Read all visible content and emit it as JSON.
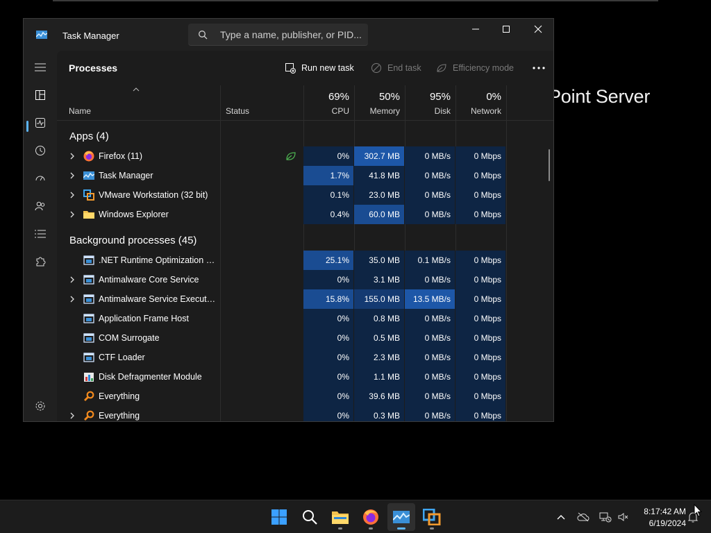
{
  "background": {
    "text": "Point Server"
  },
  "window": {
    "title": "Task Manager",
    "search_placeholder": "Type a name, publisher, or PID..."
  },
  "toolbar": {
    "page_title": "Processes",
    "run_new_task": "Run new task",
    "end_task": "End task",
    "efficiency_mode": "Efficiency mode"
  },
  "columns": {
    "name": "Name",
    "status": "Status",
    "cpu": {
      "pct": "69%",
      "label": "CPU"
    },
    "memory": {
      "pct": "50%",
      "label": "Memory"
    },
    "disk": {
      "pct": "95%",
      "label": "Disk"
    },
    "network": {
      "pct": "0%",
      "label": "Network"
    }
  },
  "groups": {
    "apps": "Apps (4)",
    "background": "Background processes (45)"
  },
  "apps": [
    {
      "name": "Firefox (11)",
      "icon": "firefox-icon",
      "status": "efficiency-leaf-icon",
      "cpu": "0%",
      "memory": "302.7 MB",
      "disk": "0 MB/s",
      "network": "0 Mbps",
      "heat": [
        0,
        3,
        0,
        0
      ]
    },
    {
      "name": "Task Manager",
      "icon": "task-manager-icon",
      "cpu": "1.7%",
      "memory": "41.8 MB",
      "disk": "0 MB/s",
      "network": "0 Mbps",
      "heat": [
        2,
        0,
        0,
        0
      ]
    },
    {
      "name": "VMware Workstation (32 bit)",
      "icon": "vmware-icon",
      "cpu": "0.1%",
      "memory": "23.0 MB",
      "disk": "0 MB/s",
      "network": "0 Mbps",
      "heat": [
        0,
        0,
        0,
        0
      ]
    },
    {
      "name": "Windows Explorer",
      "icon": "explorer-folder-icon",
      "cpu": "0.4%",
      "memory": "60.0 MB",
      "disk": "0 MB/s",
      "network": "0 Mbps",
      "heat": [
        0,
        2,
        0,
        0
      ]
    }
  ],
  "background_processes": [
    {
      "name": ".NET Runtime Optimization Se...",
      "icon": "app-window-icon",
      "expandable": false,
      "cpu": "25.1%",
      "memory": "35.0 MB",
      "disk": "0.1 MB/s",
      "network": "0 Mbps",
      "heat": [
        2,
        0,
        0,
        0
      ]
    },
    {
      "name": "Antimalware Core Service",
      "icon": "app-window-icon",
      "expandable": true,
      "cpu": "0%",
      "memory": "3.1 MB",
      "disk": "0 MB/s",
      "network": "0 Mbps",
      "heat": [
        0,
        0,
        0,
        0
      ]
    },
    {
      "name": "Antimalware Service Executable",
      "icon": "app-window-icon",
      "expandable": true,
      "cpu": "15.8%",
      "memory": "155.0 MB",
      "disk": "13.5 MB/s",
      "network": "0 Mbps",
      "heat": [
        2,
        1,
        3,
        0
      ]
    },
    {
      "name": "Application Frame Host",
      "icon": "app-window-icon",
      "expandable": false,
      "cpu": "0%",
      "memory": "0.8 MB",
      "disk": "0 MB/s",
      "network": "0 Mbps",
      "heat": [
        0,
        0,
        0,
        0
      ]
    },
    {
      "name": "COM Surrogate",
      "icon": "app-window-icon",
      "expandable": false,
      "cpu": "0%",
      "memory": "0.5 MB",
      "disk": "0 MB/s",
      "network": "0 Mbps",
      "heat": [
        0,
        0,
        0,
        0
      ]
    },
    {
      "name": "CTF Loader",
      "icon": "app-window-icon",
      "expandable": false,
      "cpu": "0%",
      "memory": "2.3 MB",
      "disk": "0 MB/s",
      "network": "0 Mbps",
      "heat": [
        0,
        0,
        0,
        0
      ]
    },
    {
      "name": "Disk Defragmenter Module",
      "icon": "defrag-icon",
      "expandable": false,
      "cpu": "0%",
      "memory": "1.1 MB",
      "disk": "0 MB/s",
      "network": "0 Mbps",
      "heat": [
        0,
        0,
        0,
        0
      ]
    },
    {
      "name": "Everything",
      "icon": "everything-search-icon",
      "expandable": false,
      "cpu": "0%",
      "memory": "39.6 MB",
      "disk": "0 MB/s",
      "network": "0 Mbps",
      "heat": [
        0,
        0,
        0,
        0
      ]
    },
    {
      "name": "Everything",
      "icon": "everything-search-icon",
      "expandable": true,
      "cpu": "0%",
      "memory": "0.3 MB",
      "disk": "0 MB/s",
      "network": "0 Mbps",
      "heat": [
        0,
        0,
        0,
        0
      ]
    }
  ],
  "taskbar": {
    "time": "8:17:42 AM",
    "date": "6/19/2024"
  },
  "colors": {
    "accent": "#5cb5f7",
    "heat_low": "#0e2544",
    "heat_high": "#1d57a8"
  }
}
